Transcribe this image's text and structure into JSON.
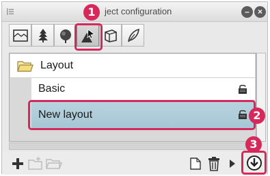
{
  "window": {
    "title": "Object configuration",
    "title_visible": "ject configuration"
  },
  "toolbar": {
    "tabs": [
      {
        "icon": "scene-icon",
        "state": "normal"
      },
      {
        "icon": "tree-icon",
        "state": "normal"
      },
      {
        "icon": "foliage-icon",
        "state": "normal"
      },
      {
        "icon": "object-cursor-icon",
        "state": "active"
      },
      {
        "icon": "box-icon",
        "state": "normal"
      },
      {
        "icon": "leaf-icon",
        "state": "normal"
      }
    ]
  },
  "list": {
    "folder_label": "Layout",
    "items": [
      {
        "label": "Basic",
        "selected": false,
        "locked": true
      },
      {
        "label": "New layout",
        "selected": true,
        "locked": true
      }
    ]
  },
  "markers": {
    "m1": "1",
    "m2": "2",
    "m3": "3"
  },
  "colors": {
    "accent": "#d6285a",
    "selection": "#a7c7d6"
  }
}
